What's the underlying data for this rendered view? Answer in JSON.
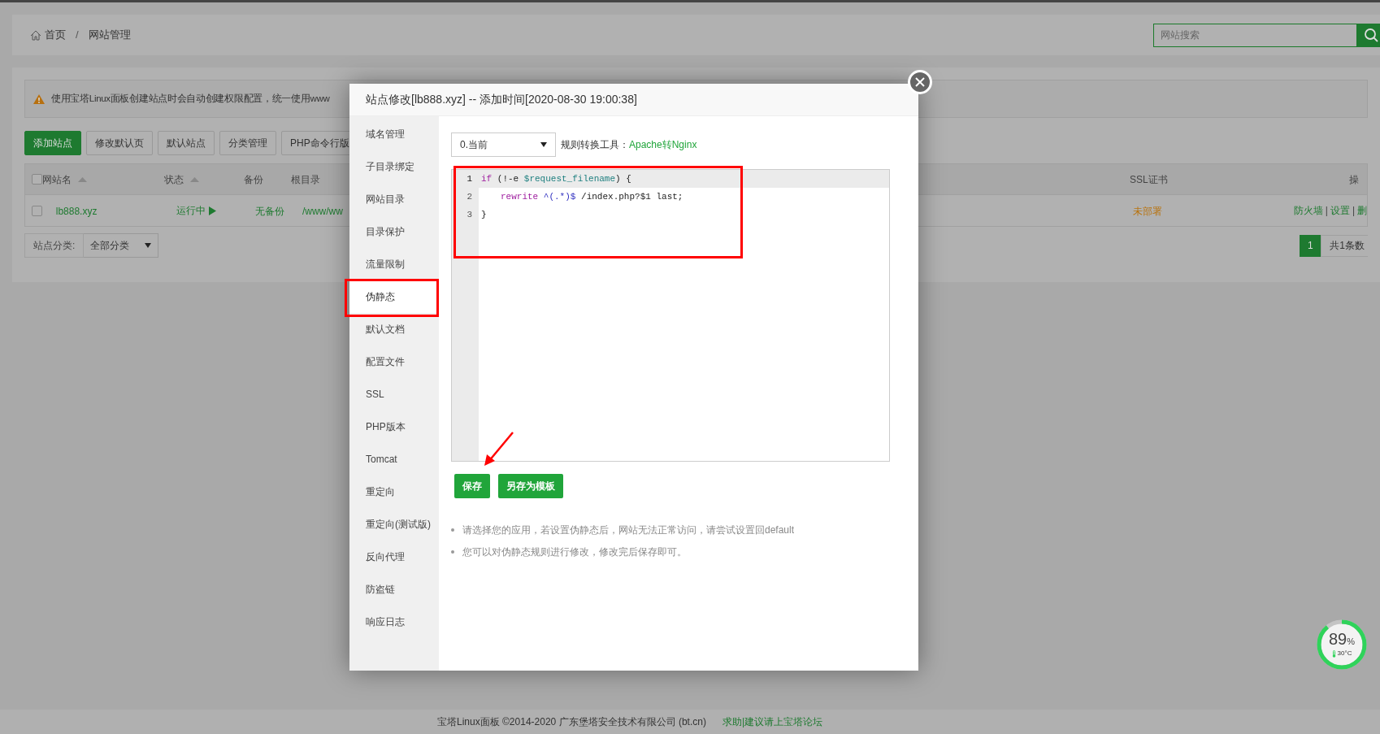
{
  "breadcrumb": {
    "items": [
      "首页",
      "网站管理"
    ],
    "separator": "/"
  },
  "search": {
    "placeholder": "网站搜索"
  },
  "alert": {
    "text": "使用宝塔Linux面板创建站点时会自动创建权限配置，统一使用www"
  },
  "toolbar_buttons": [
    {
      "label": "添加站点",
      "kind": "primary"
    },
    {
      "label": "修改默认页",
      "kind": "default"
    },
    {
      "label": "默认站点",
      "kind": "default"
    },
    {
      "label": "分类管理",
      "kind": "default"
    },
    {
      "label": "PHP命令行版",
      "kind": "default"
    }
  ],
  "table": {
    "select_all_checked": false,
    "columns": [
      {
        "label": "网站名",
        "kind": "sortable"
      },
      {
        "label": "状态",
        "kind": "sortable"
      },
      {
        "label": "备份",
        "kind": "plain"
      },
      {
        "label": "根目录",
        "kind": "plain"
      },
      {
        "label": "SSL证书",
        "kind": "plain"
      },
      {
        "label": "操",
        "kind": "plain"
      }
    ],
    "rows": [
      {
        "checked": false,
        "name": "lb888.xyz",
        "status": "运行中",
        "backup": "无备份",
        "root": "/www/ww",
        "ssl": "未部署",
        "actions": [
          "防火墙",
          "设置",
          "删"
        ],
        "action_separator": "|"
      }
    ]
  },
  "category_filter": {
    "label": "站点分类:",
    "value": "全部分类"
  },
  "pagination": {
    "pages": [
      {
        "label": "1",
        "selected": true
      }
    ],
    "summary": "共1条数"
  },
  "modal": {
    "title": "站点修改[lb888.xyz] -- 添加时间[2020-08-30 19:00:38]",
    "nav": [
      {
        "label": "域名管理",
        "selected": false
      },
      {
        "label": "子目录绑定",
        "selected": false
      },
      {
        "label": "网站目录",
        "selected": false
      },
      {
        "label": "目录保护",
        "selected": false
      },
      {
        "label": "流量限制",
        "selected": false
      },
      {
        "label": "伪静态",
        "selected": true
      },
      {
        "label": "默认文档",
        "selected": false
      },
      {
        "label": "配置文件",
        "selected": false
      },
      {
        "label": "SSL",
        "selected": false
      },
      {
        "label": "PHP版本",
        "selected": false
      },
      {
        "label": "Tomcat",
        "selected": false
      },
      {
        "label": "重定向",
        "selected": false
      },
      {
        "label": "重定向(测试版)",
        "selected": false
      },
      {
        "label": "反向代理",
        "selected": false
      },
      {
        "label": "防盗链",
        "selected": false
      },
      {
        "label": "响应日志",
        "selected": false
      }
    ],
    "version_select": {
      "value": "0.当前"
    },
    "converter": {
      "label": "规则转换工具：",
      "link": "Apache转Nginx"
    },
    "editor": {
      "lines": [
        {
          "number": "1",
          "active": true,
          "indent": false,
          "tokens": [
            {
              "text": "if",
              "kind": "keyword"
            },
            {
              "text": " (!-e ",
              "kind": "plain"
            },
            {
              "text": "$request_filename",
              "kind": "variable"
            },
            {
              "text": ") {",
              "kind": "plain"
            }
          ]
        },
        {
          "number": "2",
          "active": false,
          "indent": true,
          "tokens": [
            {
              "text": "rewrite",
              "kind": "keyword"
            },
            {
              "text": " ^(.*)$",
              "kind": "regex"
            },
            {
              "text": " /index.php?$1 last;",
              "kind": "plain"
            }
          ]
        },
        {
          "number": "3",
          "active": false,
          "indent": false,
          "tokens": [
            {
              "text": "}",
              "kind": "plain"
            }
          ]
        }
      ]
    },
    "buttons": [
      "保存",
      "另存为模板"
    ],
    "tips": [
      "请选择您的应用，若设置伪静态后，网站无法正常访问，请尝试设置回default",
      "您可以对伪静态规则进行修改，修改完后保存即可。"
    ]
  },
  "gauge": {
    "value": "89",
    "unit": "%",
    "temperature": "30°C",
    "level": 0.89
  },
  "footer": {
    "copyright": "宝塔Linux面板 ©2014-2020 广东堡塔安全技术有限公司 (bt.cn)",
    "link": "求助|建议请上宝塔论坛"
  }
}
